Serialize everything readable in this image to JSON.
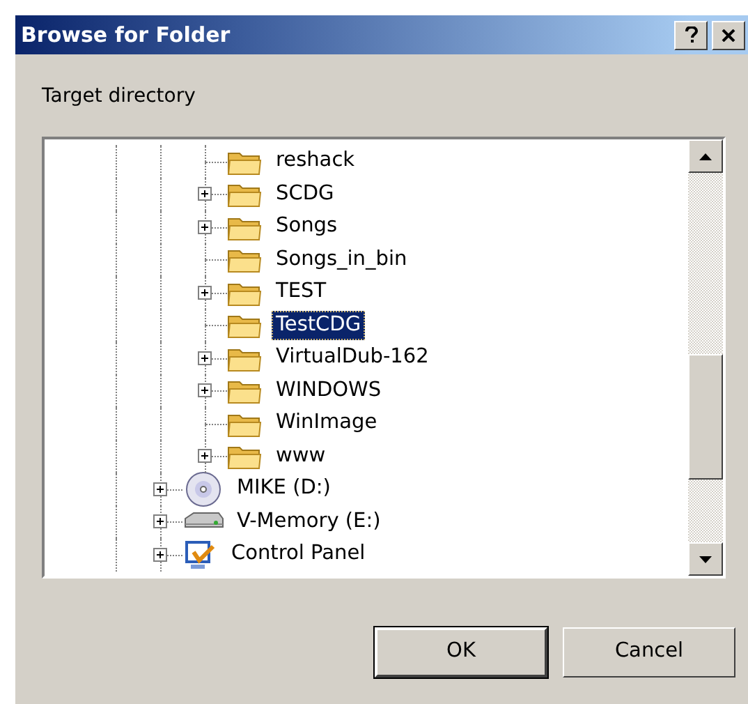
{
  "window": {
    "title": "Browse for Folder"
  },
  "title_buttons": [
    {
      "kind": "help"
    },
    {
      "kind": "close"
    }
  ],
  "prompt": "Target directory",
  "tree": {
    "items": [
      {
        "children": [
          {
            "label": "reshack",
            "kind": "folder",
            "has_children": false,
            "selected": false
          },
          {
            "label": "SCDG",
            "kind": "folder",
            "has_children": true,
            "selected": false
          },
          {
            "label": "Songs",
            "kind": "folder",
            "has_children": true,
            "selected": false
          },
          {
            "label": "Songs_in_bin",
            "kind": "folder",
            "has_children": false,
            "selected": false
          },
          {
            "label": "TEST",
            "kind": "folder",
            "has_children": true,
            "selected": false
          },
          {
            "label": "TestCDG",
            "kind": "folder",
            "has_children": false,
            "selected": true
          },
          {
            "label": "VirtualDub-162",
            "kind": "folder",
            "has_children": true,
            "selected": false
          },
          {
            "label": "WINDOWS",
            "kind": "folder",
            "has_children": true,
            "selected": false
          },
          {
            "label": "WinImage",
            "kind": "folder",
            "has_children": false,
            "selected": false
          },
          {
            "label": "www",
            "kind": "folder",
            "has_children": true,
            "selected": false
          }
        ]
      },
      {
        "label": "MIKE (D:)",
        "kind": "cd-drive",
        "has_children": true,
        "selected": false
      },
      {
        "label": "V-Memory (E:)",
        "kind": "drive",
        "has_children": true,
        "selected": false
      },
      {
        "label": "Control Panel",
        "kind": "control-panel",
        "has_children": true,
        "selected": false
      }
    ]
  },
  "buttons": [
    {
      "label": "OK",
      "default": true
    },
    {
      "label": "Cancel",
      "default": false
    }
  ]
}
